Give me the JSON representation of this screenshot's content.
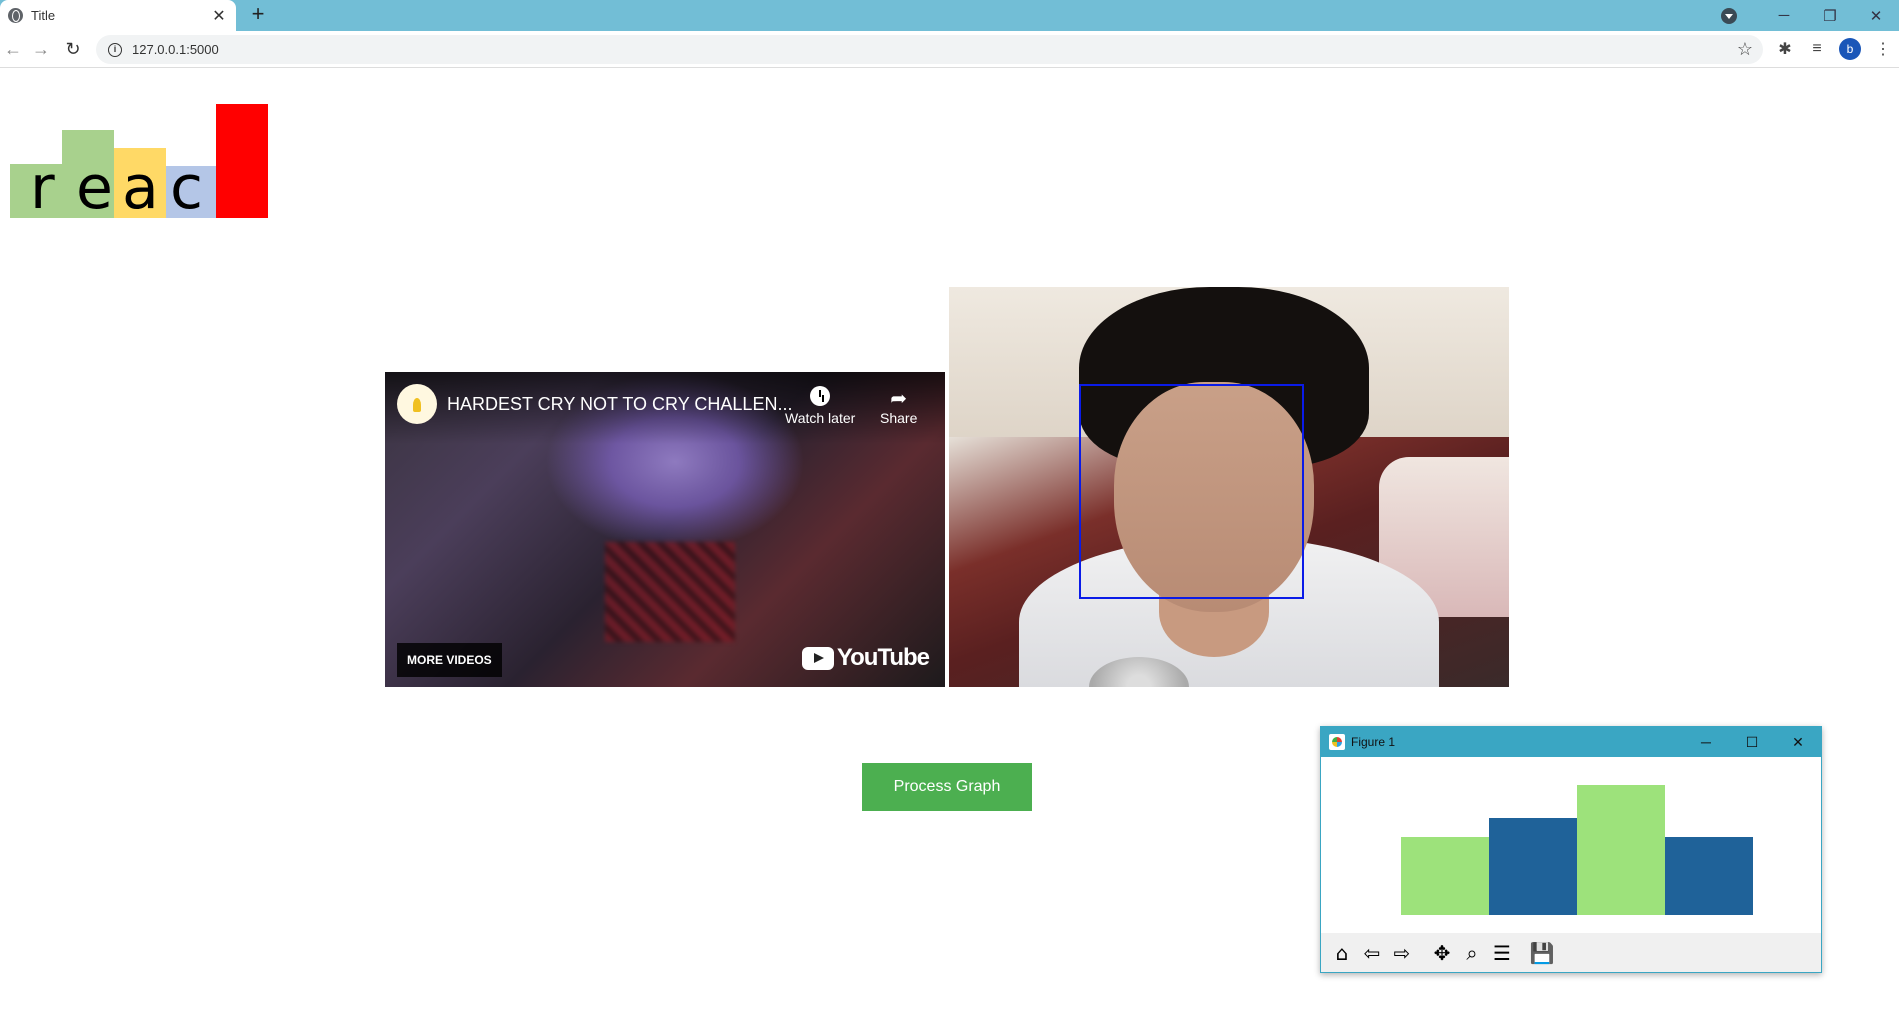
{
  "browser": {
    "tab_title": "Title",
    "tab_close": "✕",
    "new_tab": "+",
    "url": "127.0.0.1:5000",
    "avatar_letter": "b"
  },
  "logo": {
    "letters": [
      "r",
      "e",
      "a",
      "c"
    ],
    "colors": {
      "green": "#a8d18d",
      "yellow": "#ffd966",
      "blue": "#b4c6e7",
      "red": "#ff0000"
    }
  },
  "video": {
    "title": "HARDEST CRY NOT TO CRY CHALLEN...",
    "watch_later": "Watch later",
    "share": "Share",
    "more_videos": "MORE VIDEOS",
    "brand": "YouTube"
  },
  "process_button": "Process Graph",
  "figure": {
    "title": "Figure 1",
    "chart_data": {
      "type": "bar",
      "values": [
        0.6,
        0.75,
        1.0,
        0.6
      ],
      "colors": [
        "#9de27b",
        "#1f6299",
        "#9de27b",
        "#1f6299"
      ],
      "axes_visible": false
    }
  }
}
